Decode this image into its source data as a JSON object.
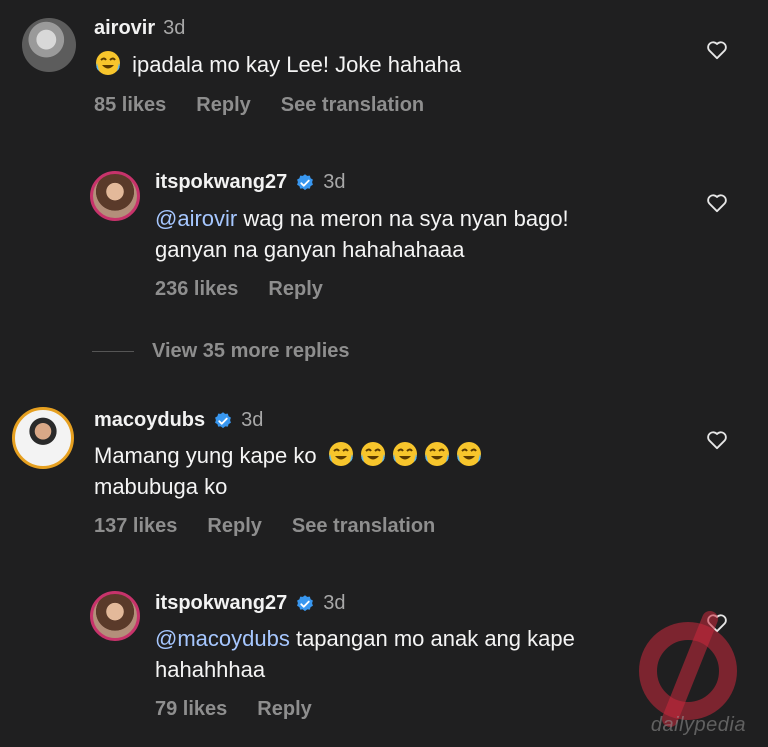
{
  "comments": [
    {
      "username": "airovir",
      "time": "3d",
      "text": "ipadala mo kay Lee! Joke hahaha",
      "likes": "85 likes",
      "reply": "Reply",
      "translate": "See translation"
    },
    {
      "username": "itspokwang27",
      "time": "3d",
      "mention": "@airovir",
      "text_line1": " wag na meron na sya nyan bago!",
      "text_line2": "ganyan na ganyan hahahahaaa",
      "likes": "236 likes",
      "reply": "Reply"
    },
    {
      "username": "macoydubs",
      "time": "3d",
      "text_line1": "Mamang yung kape ko",
      "text_line2": "mabubuga ko",
      "likes": "137 likes",
      "reply": "Reply",
      "translate": "See translation"
    },
    {
      "username": "itspokwang27",
      "time": "3d",
      "mention": "@macoydubs",
      "text_line1": " tapangan mo anak ang kape",
      "text_line2": "hahahhhaa",
      "likes": "79 likes",
      "reply": "Reply"
    }
  ],
  "view_more": "View 35 more replies",
  "watermark": "dailypedia",
  "colors": {
    "background": "#1f1f20",
    "mention": "#a6c7ff",
    "verified": "#3897f0",
    "muted": "#8e8e8e"
  },
  "icons": [
    "laughing-crying-emoji",
    "heart-icon",
    "verified-badge-icon"
  ]
}
